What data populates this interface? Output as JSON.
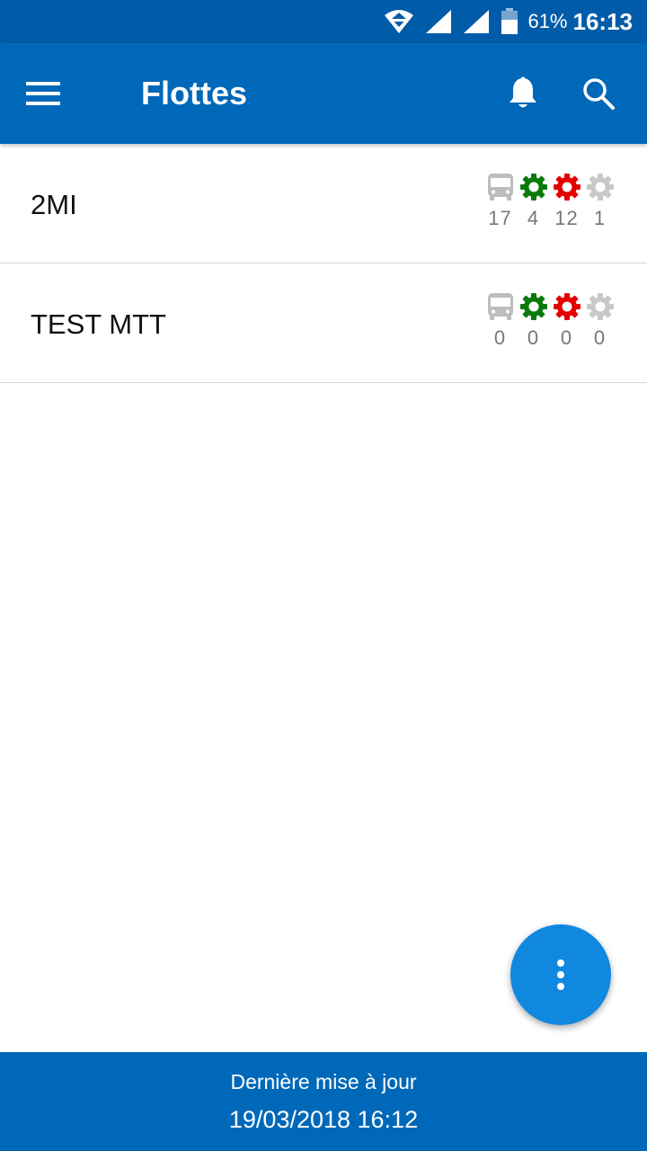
{
  "status_bar": {
    "battery_percent": "61%",
    "time": "16:13",
    "icons": [
      "wifi-icon",
      "signal-icon",
      "signal-icon",
      "battery-icon"
    ]
  },
  "app_bar": {
    "title": "Flottes",
    "icons": [
      "menu-icon",
      "bell-icon",
      "search-icon"
    ]
  },
  "colors": {
    "primary": "#0068b8",
    "status_bar": "#005ca8",
    "fab": "#1088e0",
    "vehicle_gray": "#bdbdbd",
    "ok_green": "#0b7a0b",
    "alert_red": "#e50000",
    "inactive_gray": "#c8c8c8"
  },
  "fleets": [
    {
      "name": "2MI",
      "stats": [
        {
          "icon": "bus-icon",
          "count": "17"
        },
        {
          "icon": "gear-green-icon",
          "count": "4"
        },
        {
          "icon": "gear-red-icon",
          "count": "12"
        },
        {
          "icon": "gear-gray-icon",
          "count": "1"
        }
      ]
    },
    {
      "name": "TEST MTT",
      "stats": [
        {
          "icon": "bus-icon",
          "count": "0"
        },
        {
          "icon": "gear-green-icon",
          "count": "0"
        },
        {
          "icon": "gear-red-icon",
          "count": "0"
        },
        {
          "icon": "gear-gray-icon",
          "count": "0"
        }
      ]
    }
  ],
  "fab": {
    "icon": "more-vertical-icon"
  },
  "footer": {
    "label": "Dernière mise à jour",
    "date": "19/03/2018 16:12"
  }
}
